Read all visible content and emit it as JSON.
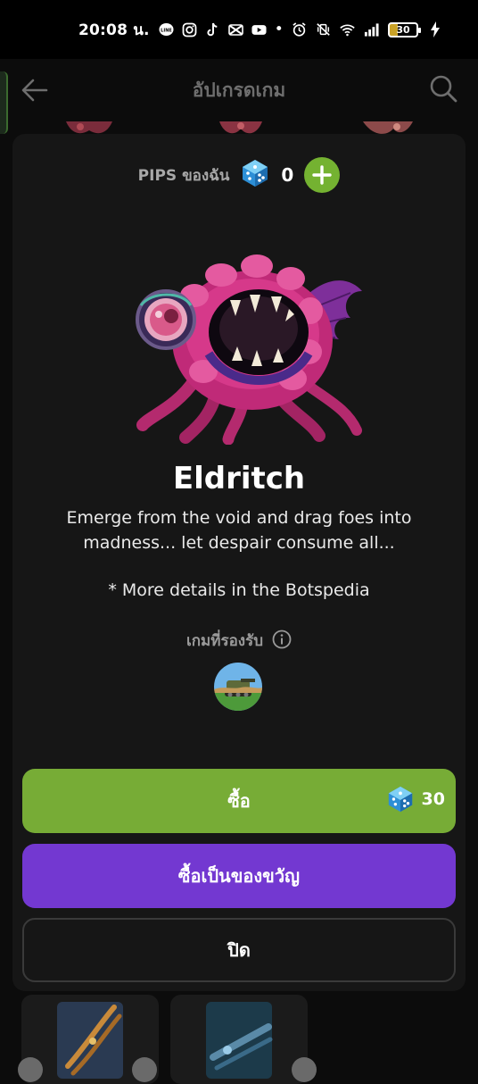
{
  "status_bar": {
    "time": "20:08 น.",
    "apps": [
      "line-icon",
      "instagram-icon",
      "tiktok-icon",
      "capcut-icon",
      "youtube-icon"
    ],
    "dot": "•",
    "battery": "30"
  },
  "header": {
    "title": "อัปเกรดเกม"
  },
  "pips": {
    "label": "PIPS ของฉัน",
    "count": "0"
  },
  "item": {
    "name": "Eldritch",
    "description": "Emerge from the void and drag foes into madness... let despair consume all...",
    "note": "* More details in the Botspedia"
  },
  "supported_games": {
    "label": "เกมที่รองรับ"
  },
  "actions": {
    "buy_label": "ซื้อ",
    "price": "30",
    "gift_label": "ซื้อเป็นของขวัญ",
    "close_label": "ปิด"
  },
  "colors": {
    "buy": "#77ac36",
    "gift": "#7338d1",
    "add": "#74b231",
    "sheet": "#161616"
  }
}
